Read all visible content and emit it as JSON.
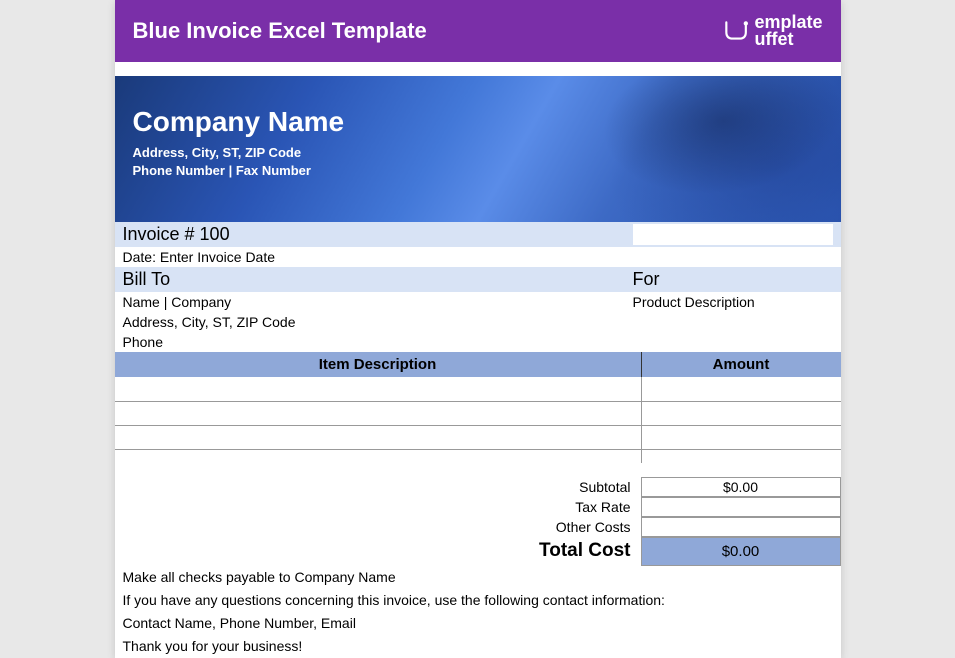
{
  "title": "Blue Invoice Excel Template",
  "brand": {
    "line1": "emplate",
    "line2": "uffet"
  },
  "company": {
    "name": "Company Name",
    "address": "Address, City, ST, ZIP Code",
    "phonefax": "Phone Number | Fax Number"
  },
  "invoice": {
    "number_label": "Invoice # 100",
    "date_label": "Date: Enter Invoice Date"
  },
  "billto": {
    "heading": "Bill To",
    "name": "Name | Company",
    "address": "Address, City, ST, ZIP Code",
    "phone": "Phone"
  },
  "for": {
    "heading": "For",
    "desc": "Product Description"
  },
  "table": {
    "col1": "Item Description",
    "col2": "Amount"
  },
  "totals": {
    "subtotal_label": "Subtotal",
    "subtotal_value": "$0.00",
    "tax_label": "Tax Rate",
    "tax_value": "",
    "other_label": "Other Costs",
    "other_value": "",
    "total_label": "Total Cost",
    "total_value": "$0.00"
  },
  "footer": {
    "l1": "Make all checks payable to Company Name",
    "l2": "If you have any questions concerning this invoice, use the following contact information:",
    "l3": "Contact Name, Phone Number, Email",
    "l4": "Thank you for your business!"
  }
}
